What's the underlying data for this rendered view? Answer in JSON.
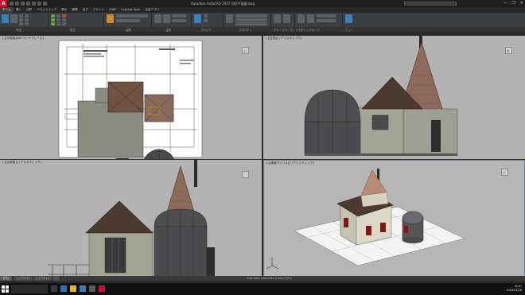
{
  "window": {
    "app_logo": "A",
    "title": "Autodesk AutoCAD 2017  別荘平面図.dwg",
    "search_placeholder": "",
    "controls": [
      "—",
      "❐",
      "✕"
    ]
  },
  "menu_tabs": [
    "ホーム",
    "挿入",
    "注釈",
    "パラメトリック",
    "表示",
    "管理",
    "出力",
    "アドイン",
    "A360",
    "Express Tools",
    "注目アプリ"
  ],
  "active_tab": "ホーム",
  "ribbon_panels": [
    "作成",
    "修正",
    "画層",
    "注釈",
    "ブロック",
    "プロパティ",
    "グループ",
    "ユーティリティ",
    "クリップボード",
    "ビュー"
  ],
  "file_tab": "",
  "viewports": {
    "top_left": {
      "label": "[-][平面図][2D ワイヤフレーム]"
    },
    "top_right": {
      "label": "[-][正面][リアリスティック]"
    },
    "bottom_left": {
      "label": "[-][左側面][リアリスティック]"
    },
    "bottom_right": {
      "label": "[-][南東アイソメ][リアリスティック]"
    }
  },
  "viewcube": {
    "n": "北",
    "s": "南",
    "top": "上",
    "front": "前"
  },
  "layout_tabs": [
    "モデル",
    "レイアウト1",
    "レイアウト2",
    "+"
  ],
  "active_layout": "モデル",
  "status": {
    "coords": "2765.3160, 2960.7350, 0.0000   モデル"
  },
  "command": {
    "placeholder": "コマンドを入力"
  },
  "taskbar": {
    "search": "",
    "time": "19:47",
    "date": "2018/01/26",
    "ime": "A"
  },
  "colors": {
    "accent": "#3d8de0",
    "brand": "#c8102e"
  }
}
